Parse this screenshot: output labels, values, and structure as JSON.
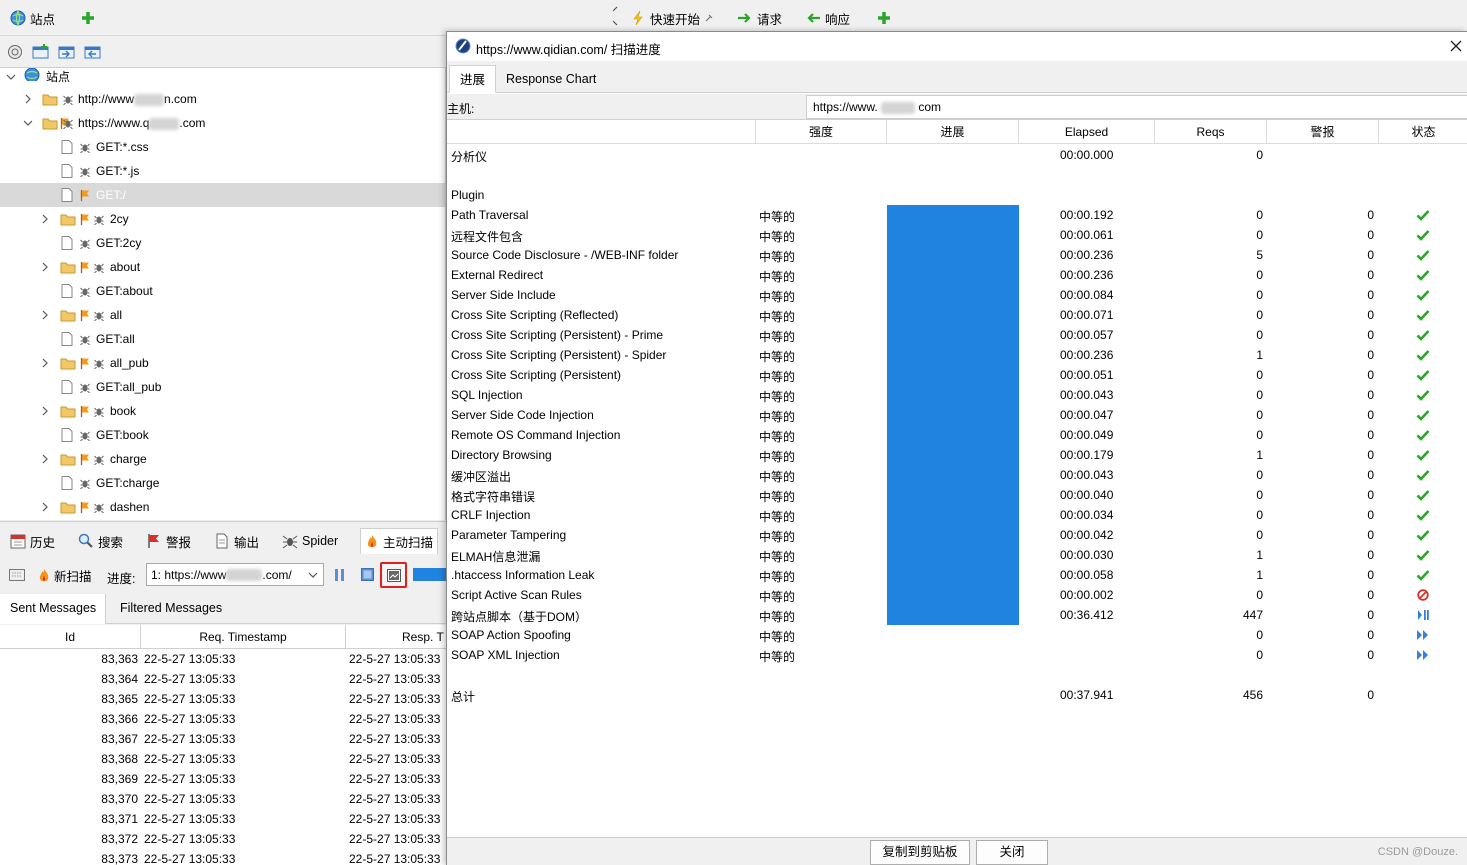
{
  "top_toolbar": {
    "sites_tab": "站点",
    "quick_start": "快速开始",
    "request": "请求",
    "response": "响应"
  },
  "tree": {
    "root": "站点",
    "rows": [
      {
        "label": "http://www",
        "label_suffix": "n.com"
      },
      {
        "label": "https://www.q",
        "label_suffix": ".com"
      },
      {
        "label": "GET:*.css"
      },
      {
        "label": "GET:*.js"
      },
      {
        "label": "GET:/"
      },
      {
        "label": "2cy"
      },
      {
        "label": "GET:2cy"
      },
      {
        "label": "about"
      },
      {
        "label": "GET:about"
      },
      {
        "label": "all"
      },
      {
        "label": "GET:all"
      },
      {
        "label": "all_pub"
      },
      {
        "label": "GET:all_pub"
      },
      {
        "label": "book"
      },
      {
        "label": "GET:book"
      },
      {
        "label": "charge"
      },
      {
        "label": "GET:charge"
      },
      {
        "label": "dashen"
      }
    ]
  },
  "bottom_tabs": {
    "history": "历史",
    "search": "搜索",
    "alerts": "警报",
    "output": "输出",
    "spider": "Spider",
    "active_scan": "主动扫描"
  },
  "scan_bar": {
    "new_scan": "新扫描",
    "progress_label": "进度:",
    "selected_prefix": "1: https://www",
    "selected_suffix": ".com/"
  },
  "message_tabs": {
    "sent": "Sent Messages",
    "filtered": "Filtered Messages"
  },
  "message_table": {
    "headers": [
      "Id",
      "Req. Timestamp",
      "Resp. T"
    ],
    "rows": [
      {
        "id": "83,363",
        "req": "22-5-27 13:05:33",
        "resp": "22-5-27 13:05:33"
      },
      {
        "id": "83,364",
        "req": "22-5-27 13:05:33",
        "resp": "22-5-27 13:05:33"
      },
      {
        "id": "83,365",
        "req": "22-5-27 13:05:33",
        "resp": "22-5-27 13:05:33"
      },
      {
        "id": "83,366",
        "req": "22-5-27 13:05:33",
        "resp": "22-5-27 13:05:33"
      },
      {
        "id": "83,367",
        "req": "22-5-27 13:05:33",
        "resp": "22-5-27 13:05:33"
      },
      {
        "id": "83,368",
        "req": "22-5-27 13:05:33",
        "resp": "22-5-27 13:05:33"
      },
      {
        "id": "83,369",
        "req": "22-5-27 13:05:33",
        "resp": "22-5-27 13:05:33"
      },
      {
        "id": "83,370",
        "req": "22-5-27 13:05:33",
        "resp": "22-5-27 13:05:33"
      },
      {
        "id": "83,371",
        "req": "22-5-27 13:05:33",
        "resp": "22-5-27 13:05:33"
      },
      {
        "id": "83,372",
        "req": "22-5-27 13:05:33",
        "resp": "22-5-27 13:05:33"
      },
      {
        "id": "83,373",
        "req": "22-5-27 13:05:33",
        "resp": "22-5-27 13:05:33"
      }
    ]
  },
  "dialog": {
    "title": "https://www.qidian.com/ 扫描进度",
    "tabs": [
      "进展",
      "Response Chart"
    ],
    "host_label": "主机:",
    "host_prefix": "https://www.",
    "host_suffix": "com",
    "columns": [
      "强度",
      "进展",
      "Elapsed",
      "Reqs",
      "警报",
      "状态"
    ],
    "section_analyser": {
      "name": "分析仪",
      "elapsed": "00:00.000",
      "reqs": "0"
    },
    "section_plugin": "Plugin",
    "rules": [
      {
        "name": "Path Traversal",
        "strength": "中等的",
        "progress": 1,
        "elapsed": "00:00.192",
        "reqs": "0",
        "alerts": "0",
        "status": "done"
      },
      {
        "name": "远程文件包含",
        "strength": "中等的",
        "progress": 1,
        "elapsed": "00:00.061",
        "reqs": "0",
        "alerts": "0",
        "status": "done"
      },
      {
        "name": "Source Code Disclosure - /WEB-INF folder",
        "strength": "中等的",
        "progress": 1,
        "elapsed": "00:00.236",
        "reqs": "5",
        "alerts": "0",
        "status": "done"
      },
      {
        "name": "External Redirect",
        "strength": "中等的",
        "progress": 1,
        "elapsed": "00:00.236",
        "reqs": "0",
        "alerts": "0",
        "status": "done"
      },
      {
        "name": "Server Side Include",
        "strength": "中等的",
        "progress": 1,
        "elapsed": "00:00.084",
        "reqs": "0",
        "alerts": "0",
        "status": "done"
      },
      {
        "name": "Cross Site Scripting (Reflected)",
        "strength": "中等的",
        "progress": 1,
        "elapsed": "00:00.071",
        "reqs": "0",
        "alerts": "0",
        "status": "done"
      },
      {
        "name": "Cross Site Scripting (Persistent) - Prime",
        "strength": "中等的",
        "progress": 1,
        "elapsed": "00:00.057",
        "reqs": "0",
        "alerts": "0",
        "status": "done"
      },
      {
        "name": "Cross Site Scripting (Persistent) - Spider",
        "strength": "中等的",
        "progress": 1,
        "elapsed": "00:00.236",
        "reqs": "1",
        "alerts": "0",
        "status": "done"
      },
      {
        "name": "Cross Site Scripting (Persistent)",
        "strength": "中等的",
        "progress": 1,
        "elapsed": "00:00.051",
        "reqs": "0",
        "alerts": "0",
        "status": "done"
      },
      {
        "name": "SQL Injection",
        "strength": "中等的",
        "progress": 1,
        "elapsed": "00:00.043",
        "reqs": "0",
        "alerts": "0",
        "status": "done"
      },
      {
        "name": "Server Side Code Injection",
        "strength": "中等的",
        "progress": 1,
        "elapsed": "00:00.047",
        "reqs": "0",
        "alerts": "0",
        "status": "done"
      },
      {
        "name": "Remote OS Command Injection",
        "strength": "中等的",
        "progress": 1,
        "elapsed": "00:00.049",
        "reqs": "0",
        "alerts": "0",
        "status": "done"
      },
      {
        "name": "Directory Browsing",
        "strength": "中等的",
        "progress": 1,
        "elapsed": "00:00.179",
        "reqs": "1",
        "alerts": "0",
        "status": "done"
      },
      {
        "name": "缓冲区溢出",
        "strength": "中等的",
        "progress": 1,
        "elapsed": "00:00.043",
        "reqs": "0",
        "alerts": "0",
        "status": "done"
      },
      {
        "name": "格式字符串错误",
        "strength": "中等的",
        "progress": 1,
        "elapsed": "00:00.040",
        "reqs": "0",
        "alerts": "0",
        "status": "done"
      },
      {
        "name": "CRLF Injection",
        "strength": "中等的",
        "progress": 1,
        "elapsed": "00:00.034",
        "reqs": "0",
        "alerts": "0",
        "status": "done"
      },
      {
        "name": "Parameter Tampering",
        "strength": "中等的",
        "progress": 1,
        "elapsed": "00:00.042",
        "reqs": "0",
        "alerts": "0",
        "status": "done"
      },
      {
        "name": "ELMAH信息泄漏",
        "strength": "中等的",
        "progress": 1,
        "elapsed": "00:00.030",
        "reqs": "1",
        "alerts": "0",
        "status": "done"
      },
      {
        "name": ".htaccess Information Leak",
        "strength": "中等的",
        "progress": 1,
        "elapsed": "00:00.058",
        "reqs": "1",
        "alerts": "0",
        "status": "done"
      },
      {
        "name": "Script Active Scan Rules",
        "strength": "中等的",
        "progress": 1,
        "elapsed": "00:00.002",
        "reqs": "0",
        "alerts": "0",
        "status": "skipped"
      },
      {
        "name": "跨站点脚本（基于DOM）",
        "strength": "中等的",
        "progress": 1,
        "elapsed": "00:36.412",
        "reqs": "447",
        "alerts": "0",
        "status": "running"
      },
      {
        "name": "SOAP Action Spoofing",
        "strength": "中等的",
        "progress": 0,
        "elapsed": "",
        "reqs": "0",
        "alerts": "0",
        "status": "pending"
      },
      {
        "name": "SOAP XML Injection",
        "strength": "中等的",
        "progress": 0,
        "elapsed": "",
        "reqs": "0",
        "alerts": "0",
        "status": "pending"
      }
    ],
    "total": {
      "name": "总计",
      "elapsed": "00:37.941",
      "reqs": "456",
      "alerts": "0"
    },
    "copy_button": "复制到剪贴板",
    "close_button": "关闭",
    "watermark": "CSDN @Douze."
  },
  "colors": {
    "progress_fill": "#2183e0",
    "check_green": "#2aa52a",
    "error_red": "#d9302a",
    "pending_blue": "#3a7fd6",
    "highlight_red": "#e02020"
  }
}
